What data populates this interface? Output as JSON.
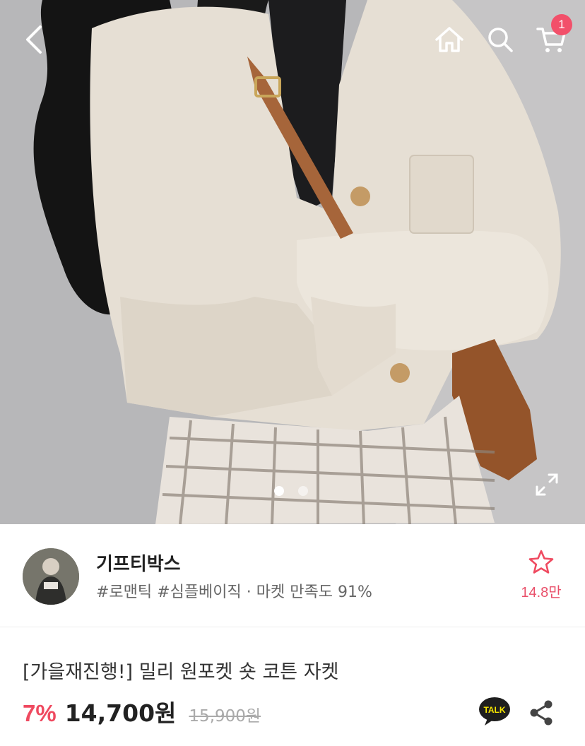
{
  "header": {
    "cart_count": "1",
    "icons": [
      "back-arrow-icon",
      "home-icon",
      "search-icon",
      "cart-icon"
    ]
  },
  "gallery": {
    "image_count": 2,
    "active_index": 0,
    "expand_icon": "expand-icon"
  },
  "shop": {
    "name": "기프티박스",
    "tags": "#로맨틱 #심플베이직 · 마켓 만족도 91%",
    "favorite_count": "14.8만",
    "favorite_icon": "star-outline-icon"
  },
  "product": {
    "title": "[가을재진행!] 밀리 원포켓 숏 코튼 자켓",
    "discount": "7%",
    "price": "14,700원",
    "original_price": "15,900원",
    "talk_label": "TALK"
  },
  "colors": {
    "accent": "#ef4a60",
    "badge": "#f2506a"
  }
}
